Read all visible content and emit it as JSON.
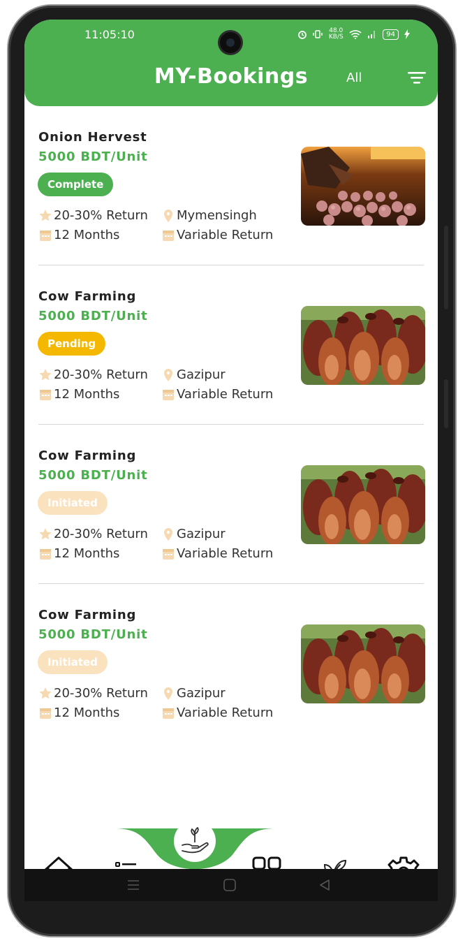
{
  "status_bar": {
    "time": "11:05:10",
    "net_speed": "48.0\nKB/S",
    "battery": "94"
  },
  "header": {
    "title": "MY-Bookings",
    "filter_label": "All"
  },
  "bookings": [
    {
      "title": "Onion Hervest",
      "price": "5000 BDT/Unit",
      "status": "Complete",
      "status_color": "#4caf50",
      "return": "20-30%  Return",
      "location": "Mymensingh",
      "duration": "12 Months",
      "return_type": "Variable Return",
      "image": "onion-harvest-photo"
    },
    {
      "title": "Cow Farming",
      "price": "5000 BDT/Unit",
      "status": "Pending",
      "status_color": "#f5b800",
      "return": "20-30%  Return",
      "location": "Gazipur",
      "duration": "12 Months",
      "return_type": "Variable Return",
      "image": "cow-farming-photo"
    },
    {
      "title": "Cow Farming",
      "price": "5000 BDT/Unit",
      "status": "Initiated",
      "status_color": "#fbe2bf",
      "return": "20-30%  Return",
      "location": "Gazipur",
      "duration": "12 Months",
      "return_type": "Variable Return",
      "image": "cow-farming-photo"
    },
    {
      "title": "Cow Farming",
      "price": "5000 BDT/Unit",
      "status": "Initiated",
      "status_color": "#fbe2bf",
      "return": "20-30%  Return",
      "location": "Gazipur",
      "duration": "12 Months",
      "return_type": "Variable Return",
      "image": "cow-farming-photo"
    }
  ],
  "bottom_nav": {
    "items": [
      "home-icon",
      "list-icon",
      "invest-icon",
      "grid-icon",
      "leaf-icon",
      "settings-icon"
    ]
  },
  "colors": {
    "accent": "#4caf50",
    "pending": "#f5b800",
    "initiated": "#fbe2bf",
    "meta_icon": "#f6d9b0"
  }
}
